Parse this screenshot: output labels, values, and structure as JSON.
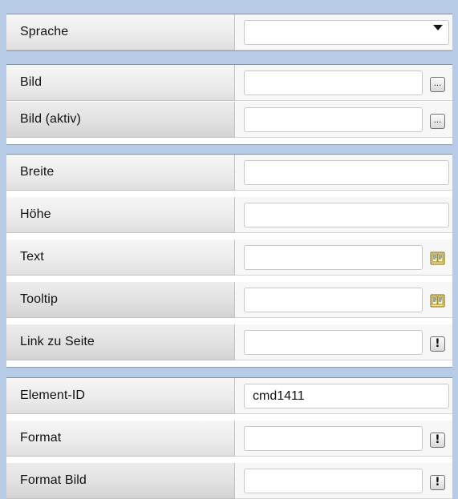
{
  "language": {
    "label": "Sprache",
    "value": ""
  },
  "image_group": {
    "bild": {
      "label": "Bild",
      "value": "",
      "button": "..."
    },
    "bild_aktiv": {
      "label": "Bild (aktiv)",
      "value": "",
      "button": "..."
    }
  },
  "layout_group": {
    "breite": {
      "label": "Breite",
      "value": ""
    },
    "hoehe": {
      "label": "Höhe",
      "value": ""
    },
    "text": {
      "label": "Text",
      "value": "",
      "icon": "book-icon"
    },
    "tooltip": {
      "label": "Tooltip",
      "value": "",
      "icon": "book-icon"
    },
    "link": {
      "label": "Link zu Seite",
      "value": "",
      "button": "!"
    }
  },
  "element_group": {
    "element_id": {
      "label": "Element-ID",
      "value": "cmd1411"
    },
    "format": {
      "label": "Format",
      "value": "",
      "button": "!"
    },
    "format_bild": {
      "label": "Format Bild",
      "value": "",
      "button": "!"
    }
  },
  "colors": {
    "background": "#b7cbe6",
    "label_gradient_top": "#f6f6f6",
    "label_gradient_bottom": "#dfdfdf",
    "border": "#c8c8c8"
  }
}
